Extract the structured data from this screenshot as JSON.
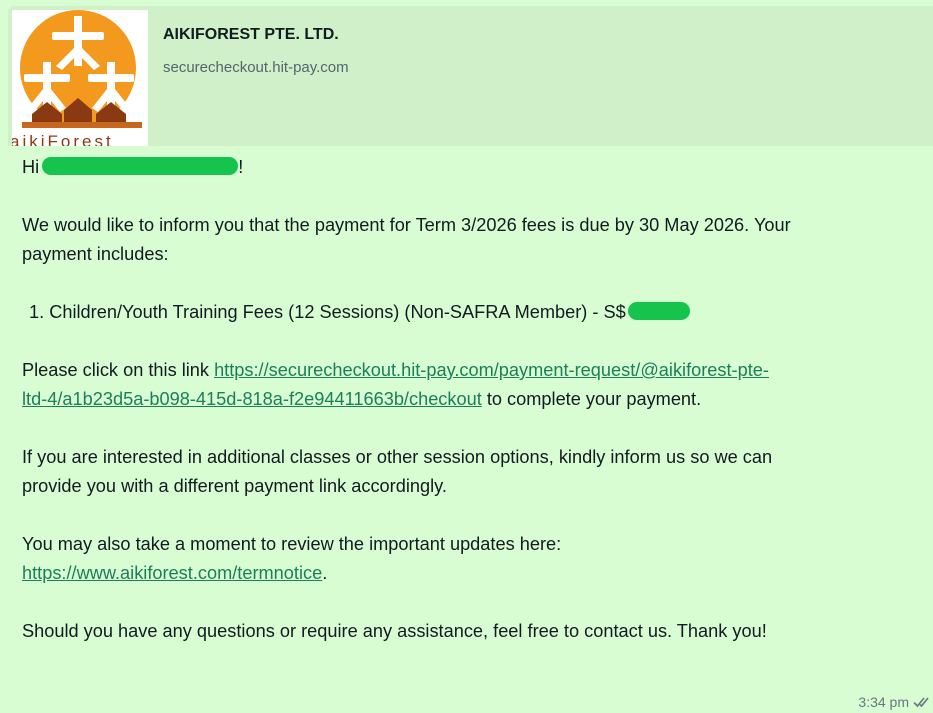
{
  "preview": {
    "title": "AIKIFOREST PTE. LTD.",
    "domain": "securecheckout.hit-pay.com",
    "logo_text": "aikiForest",
    "logo_color": "#f39a1e"
  },
  "message": {
    "greeting_prefix": "Hi ",
    "greeting_suffix": "!",
    "intro_line1": "We would like to inform you that the payment for Term 3/2026 fees is due by 30 May 2026. Your",
    "intro_line2": "payment includes:",
    "list_item": "1.  Children/Youth Training Fees (12 Sessions) (Non-SAFRA Member) - S$",
    "click_prefix": "Please click on this link ",
    "payment_link_line1": "https://securecheckout.hit-pay.com/payment-request/@aikiforest-pte-",
    "payment_link_line2": "ltd-4/a1b23d5a-b098-415d-818a-f2e94411663b/checkout",
    "click_suffix": " to complete your payment.",
    "additional_line1": "If you are interested in additional classes or other session options, kindly inform us so we can",
    "additional_line2": "provide you with a different payment link accordingly.",
    "review_line": "You may also take a moment to review the important updates here:",
    "notice_link": "https://www.aikiforest.com/termnotice",
    "notice_suffix": ".",
    "closing": "Should you have any questions or require any assistance, feel free to contact us. Thank you!"
  },
  "meta": {
    "time": "3:34 pm",
    "status_icon": "double-check-icon"
  },
  "colors": {
    "bubble": "#d9fdd3",
    "redaction": "#15c34d",
    "link": "#1a7f5a"
  }
}
